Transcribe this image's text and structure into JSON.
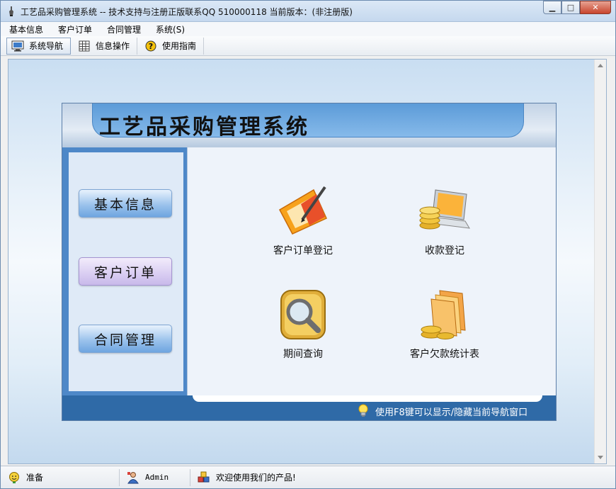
{
  "window": {
    "title": "工艺品采购管理系统 -- 技术支持与注册正版联系QQ 510000118    当前版本：(非注册版)",
    "controls": {
      "minimize": "▁",
      "maximize": "□",
      "close": "✕"
    }
  },
  "menubar": {
    "items": [
      {
        "label": "基本信息"
      },
      {
        "label": "客户订单"
      },
      {
        "label": "合同管理"
      },
      {
        "label": "系统(S)"
      }
    ]
  },
  "toolbar": {
    "items": [
      {
        "label": "系统导航",
        "icon": "monitor-icon",
        "active": true
      },
      {
        "label": "信息操作",
        "icon": "grid-icon",
        "active": false
      },
      {
        "label": "使用指南",
        "icon": "help-icon",
        "active": false
      }
    ]
  },
  "panel": {
    "title": "工艺品采购管理系统",
    "nav_buttons": [
      {
        "label": "基本信息",
        "selected": false
      },
      {
        "label": "客户订单",
        "selected": true
      },
      {
        "label": "合同管理",
        "selected": false
      }
    ],
    "features": [
      {
        "label": "客户订单登记",
        "icon": "order-register-icon"
      },
      {
        "label": "收款登记",
        "icon": "payment-register-icon"
      },
      {
        "label": "期间查询",
        "icon": "period-query-icon"
      },
      {
        "label": "客户欠款统计表",
        "icon": "debt-report-icon"
      }
    ],
    "footer_tip": "使用F8键可以显示/隐藏当前导航窗口"
  },
  "statusbar": {
    "status": "准备",
    "user": "Admin",
    "message": "欢迎使用我们的产品!"
  },
  "colors": {
    "header_band": "#6fa8e2",
    "footer": "#2f6aa7",
    "nav_button": "#86b6e8",
    "nav_selected": "#d9cdf2"
  }
}
